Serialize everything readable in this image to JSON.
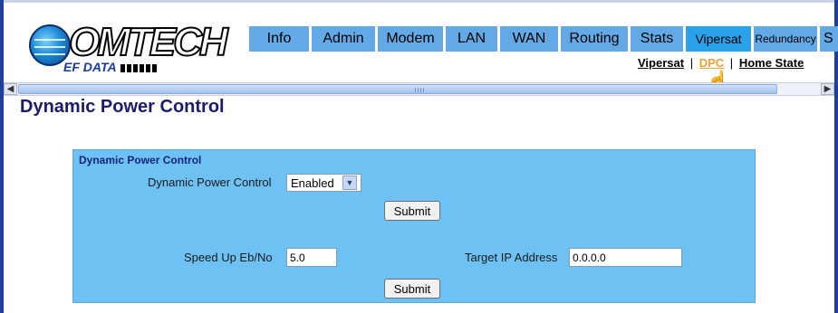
{
  "logo": {
    "word": "OMTECH",
    "sub": "EF DATA"
  },
  "nav": {
    "tabs": [
      "Info",
      "Admin",
      "Modem",
      "LAN",
      "WAN",
      "Routing",
      "Stats",
      "Vipersat",
      "Redundancy",
      "S"
    ],
    "active": "Vipersat"
  },
  "subnav": {
    "links": [
      "Vipersat",
      "DPC",
      "Home State"
    ],
    "separator": "|",
    "current": "DPC"
  },
  "page": {
    "title": "Dynamic Power Control"
  },
  "panel": {
    "heading": "Dynamic Power Control",
    "dpc_label": "Dynamic Power Control",
    "dpc_value": "Enabled",
    "submit_label": "Submit",
    "speed_label": "Speed Up Eb/No",
    "speed_value": "5.0",
    "target_label": "Target IP Address",
    "target_value": "0.0.0.0"
  },
  "colors": {
    "tab": "#62a9e6",
    "tab_active": "#2aa2ea",
    "panel_bg": "#6ec2f3",
    "title": "#1c1c6a",
    "current_link": "#e8a23c"
  },
  "icons": [
    "globe-logo-icon",
    "hand-cursor-icon",
    "scroll-left-icon",
    "scroll-right-icon",
    "chevron-down-icon"
  ]
}
